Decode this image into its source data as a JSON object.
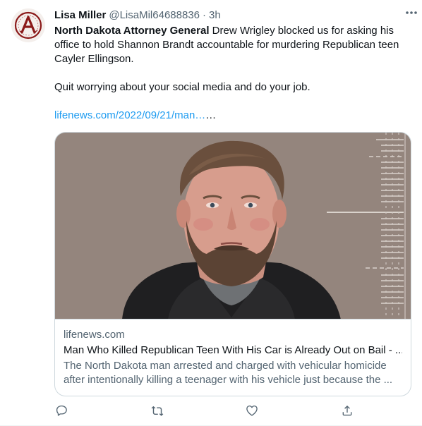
{
  "author": {
    "name": "Lisa Miller",
    "handle": "@LisaMil64688836",
    "separator": "·",
    "time": "3h"
  },
  "tweet": {
    "text_bold": "North Dakota Attorney General",
    "text_rest": " Drew Wrigley blocked us for asking his office to hold Shannon Brandt accountable for murdering Republican teen Cayler Ellingson.",
    "line2": "Quit worrying about your social media and do your job.",
    "link": "lifenews.com/2022/09/21/man…",
    "link_suffix": "…"
  },
  "card": {
    "domain": "lifenews.com",
    "title": "Man Who Killed Republican Teen With His Car is Already Out on Bail - ...",
    "description": "The North Dakota man arrested and charged with vehicular homicide after intentionally killing a teenager with his vehicle just because the ..."
  },
  "icons": {
    "avatar": "circled-a-logo",
    "more": "more-icon",
    "reply": "reply-icon",
    "retweet": "retweet-icon",
    "like": "heart-icon",
    "share": "share-icon"
  },
  "colors": {
    "link": "#1d9bf0",
    "secondary_text": "#536471",
    "border": "#cfd9de",
    "avatar_red": "#8b1a1a"
  }
}
